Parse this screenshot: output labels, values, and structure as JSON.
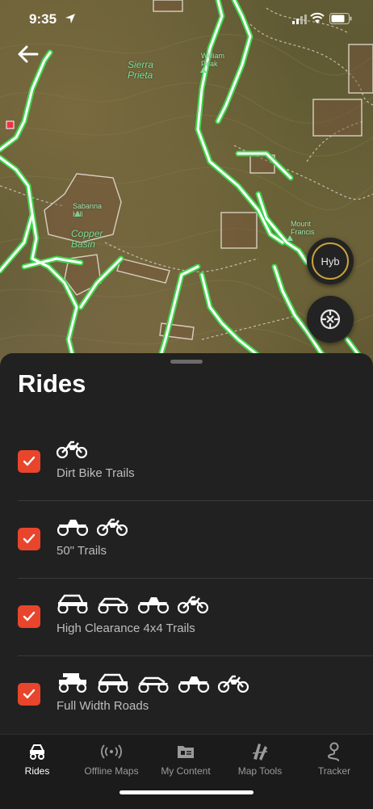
{
  "status_bar": {
    "time": "9:35"
  },
  "map": {
    "labels": {
      "sierra_prieta": "Sierra\nPrieta",
      "william_peak": "William\nPeak",
      "sabanna_hill": "Sabanna\nHill",
      "copper_basin": "Copper\nBasin",
      "mount_francis": "Mount\nFrancis"
    },
    "layer_button": "Hyb",
    "trail_color": "#3fd44a",
    "accent_ring": "#c9a23a"
  },
  "sheet": {
    "title": "Rides",
    "rides": [
      {
        "label": "Dirt Bike Trails",
        "checked": true,
        "icons": [
          "dirt-bike-icon"
        ]
      },
      {
        "label": "50\" Trails",
        "checked": true,
        "icons": [
          "atv-icon",
          "dirt-bike-icon"
        ]
      },
      {
        "label": "High Clearance 4x4 Trails",
        "checked": true,
        "icons": [
          "utv-icon",
          "side-by-side-icon",
          "atv-icon",
          "dirt-bike-icon"
        ]
      },
      {
        "label": "Full Width Roads",
        "checked": true,
        "icons": [
          "truck-icon",
          "utv-icon",
          "side-by-side-icon",
          "atv-icon",
          "dirt-bike-icon"
        ]
      }
    ],
    "checkbox_color": "#e8452c"
  },
  "tabbar": {
    "tabs": [
      {
        "label": "Rides",
        "icon": "rides-icon",
        "active": true
      },
      {
        "label": "Offline Maps",
        "icon": "offline-maps-icon",
        "active": false
      },
      {
        "label": "My Content",
        "icon": "my-content-icon",
        "active": false
      },
      {
        "label": "Map Tools",
        "icon": "map-tools-icon",
        "active": false
      },
      {
        "label": "Tracker",
        "icon": "tracker-icon",
        "active": false
      }
    ]
  }
}
